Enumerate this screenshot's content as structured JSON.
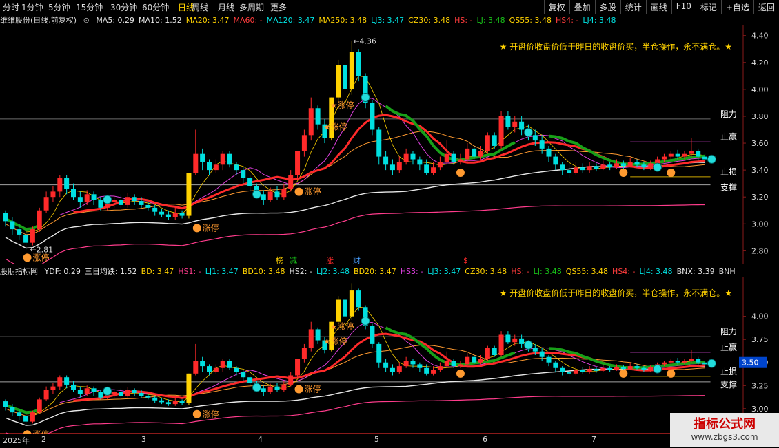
{
  "periods": [
    "分时",
    "1分钟",
    "5分钟",
    "15分钟",
    "30分钟",
    "60分钟",
    "日线",
    "周线",
    "月线",
    "多周期",
    "更多"
  ],
  "active_period": "日线",
  "right_tools": [
    "复权",
    "叠加",
    "多股",
    "统计",
    "画线",
    "F10",
    "标记",
    "+自选",
    "返回"
  ],
  "colors": {
    "up": "#ff2a2a",
    "down": "#00e0e0",
    "yellow": "#ffd200",
    "green": "#18a018",
    "white": "#e8e8e8",
    "pink": "#ff3c8c",
    "magenta": "#e040e0",
    "orange": "#ff9a30"
  },
  "main_panel": {
    "stock_title": "维维股份(日线,前复权)",
    "legend": [
      {
        "text": "MA5: 0.29",
        "color": "#e8e8e8"
      },
      {
        "text": "MA10: 1.52",
        "color": "#e8e8e8"
      },
      {
        "text": "MA20: 3.47",
        "color": "#ffd200"
      },
      {
        "text": "MA60: -",
        "color": "#ff3c3c"
      },
      {
        "text": "MA120: 3.47",
        "color": "#00e0e0"
      },
      {
        "text": "MA250: 3.48",
        "color": "#ffd200"
      },
      {
        "text": "LJ3: 3.47",
        "color": "#00e0e0"
      },
      {
        "text": "CZ30: 3.48",
        "color": "#ffd200"
      },
      {
        "text": "HS: -",
        "color": "#ff3c3c"
      },
      {
        "text": "LJ: 3.48",
        "color": "#18c018"
      },
      {
        "text": "QS55: 3.48",
        "color": "#ffd200"
      },
      {
        "text": "HS4: -",
        "color": "#ff3c3c"
      },
      {
        "text": "LJ4: 3.48",
        "color": "#00e0e0"
      }
    ],
    "note": "★ 开盘价收盘价低于昨日的收盘价买，半仓操作，永不满仓。★",
    "labels": {
      "resist": "阻力",
      "profit": "止赢",
      "stop": "止损",
      "support": "支撑",
      "limit_up": "涨停",
      "high": "4.36",
      "low": "2.81"
    },
    "axis_ticks": [
      "4.40",
      "4.20",
      "4.00",
      "3.80",
      "3.60",
      "3.40",
      "3.20",
      "3.00",
      "2.80"
    ],
    "markers": [
      "榜",
      "减",
      "涨",
      "财",
      "$"
    ]
  },
  "sub_panel": {
    "title": "股朋指标网",
    "legend": [
      {
        "text": "YDF: 0.29",
        "color": "#e8e8e8"
      },
      {
        "text": "三日均跌: 1.52",
        "color": "#e8e8e8"
      },
      {
        "text": "BD: 3.47",
        "color": "#ffd200"
      },
      {
        "text": "HS1: -",
        "color": "#ff3c8c"
      },
      {
        "text": "LJ1: 3.47",
        "color": "#00e0e0"
      },
      {
        "text": "BD10: 3.48",
        "color": "#ffd200"
      },
      {
        "text": "HS2: -",
        "color": "#e8e8e8"
      },
      {
        "text": "LJ2: 3.48",
        "color": "#00e0e0"
      },
      {
        "text": "BD20: 3.47",
        "color": "#ffd200"
      },
      {
        "text": "HS3: -",
        "color": "#e040e0"
      },
      {
        "text": "LJ3: 3.47",
        "color": "#00e0e0"
      },
      {
        "text": "CZ30: 3.48",
        "color": "#ffd200"
      },
      {
        "text": "HS: -",
        "color": "#ff3c3c"
      },
      {
        "text": "LJ: 3.48",
        "color": "#18c018"
      },
      {
        "text": "QS55: 3.48",
        "color": "#ffd200"
      },
      {
        "text": "HS4: -",
        "color": "#ff3c3c"
      },
      {
        "text": "LJ4: 3.48",
        "color": "#00e0e0"
      },
      {
        "text": "BNX: 3.39",
        "color": "#e8e8e8"
      },
      {
        "text": "BNH",
        "color": "#e8e8e8"
      }
    ],
    "note": "★ 开盘价收盘价低于昨日的收盘价买，半仓操作，永不满仓。★",
    "labels": {
      "resist": "阻力",
      "profit": "止赢",
      "stop": "止损",
      "support": "支撑",
      "limit_up": "涨停"
    },
    "axis_ticks": [
      "4.00",
      "3.75",
      "3.50",
      "3.25",
      "3.00"
    ],
    "current_price": "3.50"
  },
  "date_axis": [
    "2025年",
    "2",
    "3",
    "4",
    "5",
    "6",
    "7"
  ],
  "watermark": {
    "title": "指标公式网",
    "url": "www.zbgs3.com"
  },
  "chart_data": [
    {
      "type": "candlestick",
      "title": "维维股份(日线,前复权)",
      "ylim": [
        2.72,
        4.46
      ],
      "grid": false,
      "candles": [
        [
          3.08,
          3.02,
          3.1,
          2.98
        ],
        [
          3.02,
          2.96,
          3.05,
          2.92
        ],
        [
          2.96,
          2.92,
          3.0,
          2.88
        ],
        [
          2.92,
          2.86,
          2.95,
          2.81
        ],
        [
          2.86,
          2.96,
          2.98,
          2.84
        ],
        [
          2.96,
          3.1,
          3.12,
          2.94
        ],
        [
          3.1,
          3.2,
          3.24,
          3.08
        ],
        [
          3.2,
          3.24,
          3.28,
          3.16
        ],
        [
          3.24,
          3.34,
          3.36,
          3.2
        ],
        [
          3.34,
          3.26,
          3.36,
          3.22
        ],
        [
          3.26,
          3.2,
          3.3,
          3.18
        ],
        [
          3.2,
          3.16,
          3.24,
          3.12
        ],
        [
          3.16,
          3.22,
          3.25,
          3.14
        ],
        [
          3.22,
          3.18,
          3.24,
          3.14
        ],
        [
          3.18,
          3.12,
          3.2,
          3.1
        ],
        [
          3.12,
          3.16,
          3.19,
          3.1
        ],
        [
          3.16,
          3.18,
          3.21,
          3.12
        ],
        [
          3.18,
          3.14,
          3.22,
          3.12
        ],
        [
          3.14,
          3.2,
          3.23,
          3.12
        ],
        [
          3.2,
          3.17,
          3.22,
          3.14
        ],
        [
          3.17,
          3.14,
          3.2,
          3.12
        ],
        [
          3.14,
          3.12,
          3.16,
          3.1
        ],
        [
          3.12,
          3.09,
          3.14,
          3.06
        ],
        [
          3.09,
          3.07,
          3.11,
          3.05
        ],
        [
          3.07,
          3.05,
          3.1,
          3.03
        ],
        [
          3.05,
          3.08,
          3.12,
          3.03
        ],
        [
          3.08,
          3.06,
          3.1,
          3.04
        ],
        [
          3.06,
          3.38,
          3.38,
          3.04
        ],
        [
          3.38,
          3.52,
          3.7,
          3.36
        ],
        [
          3.52,
          3.46,
          3.56,
          3.4
        ],
        [
          3.46,
          3.4,
          3.48,
          3.36
        ],
        [
          3.4,
          3.44,
          3.48,
          3.38
        ],
        [
          3.44,
          3.52,
          3.54,
          3.4
        ],
        [
          3.52,
          3.44,
          3.54,
          3.42
        ],
        [
          3.44,
          3.4,
          3.46,
          3.36
        ],
        [
          3.4,
          3.34,
          3.42,
          3.3
        ],
        [
          3.34,
          3.28,
          3.36,
          3.24
        ],
        [
          3.28,
          3.22,
          3.3,
          3.2
        ],
        [
          3.22,
          3.18,
          3.25,
          3.14
        ],
        [
          3.18,
          3.24,
          3.27,
          3.16
        ],
        [
          3.24,
          3.2,
          3.28,
          3.18
        ],
        [
          3.2,
          3.26,
          3.3,
          3.18
        ],
        [
          3.26,
          3.36,
          3.4,
          3.24
        ],
        [
          3.36,
          3.54,
          3.54,
          3.34
        ],
        [
          3.54,
          3.66,
          3.7,
          3.5
        ],
        [
          3.66,
          3.86,
          3.94,
          3.62
        ],
        [
          3.86,
          3.74,
          3.88,
          3.7
        ],
        [
          3.74,
          3.64,
          3.78,
          3.6
        ],
        [
          3.64,
          3.94,
          3.94,
          3.62
        ],
        [
          3.94,
          4.18,
          4.22,
          3.9
        ],
        [
          4.18,
          4.0,
          4.34,
          3.96
        ],
        [
          4.0,
          4.28,
          4.36,
          3.96
        ],
        [
          4.28,
          4.1,
          4.3,
          4.06
        ],
        [
          4.1,
          3.9,
          4.12,
          3.86
        ],
        [
          3.9,
          3.7,
          3.92,
          3.66
        ],
        [
          3.7,
          3.5,
          3.72,
          3.44
        ],
        [
          3.5,
          3.44,
          3.54,
          3.4
        ],
        [
          3.44,
          3.4,
          3.48,
          3.36
        ],
        [
          3.4,
          3.46,
          3.5,
          3.38
        ],
        [
          3.46,
          3.52,
          3.56,
          3.44
        ],
        [
          3.52,
          3.48,
          3.54,
          3.44
        ],
        [
          3.48,
          3.44,
          3.5,
          3.4
        ],
        [
          3.44,
          3.38,
          3.48,
          3.36
        ],
        [
          3.38,
          3.42,
          3.46,
          3.36
        ],
        [
          3.42,
          3.46,
          3.5,
          3.4
        ],
        [
          3.46,
          3.52,
          3.62,
          3.44
        ],
        [
          3.52,
          3.46,
          3.54,
          3.44
        ],
        [
          3.46,
          3.48,
          3.52,
          3.44
        ],
        [
          3.48,
          3.56,
          3.6,
          3.46
        ],
        [
          3.56,
          3.5,
          3.58,
          3.48
        ],
        [
          3.5,
          3.54,
          3.58,
          3.48
        ],
        [
          3.54,
          3.66,
          3.68,
          3.52
        ],
        [
          3.66,
          3.58,
          3.68,
          3.56
        ],
        [
          3.58,
          3.8,
          3.84,
          3.56
        ],
        [
          3.8,
          3.72,
          3.84,
          3.7
        ],
        [
          3.72,
          3.76,
          3.8,
          3.68
        ],
        [
          3.76,
          3.7,
          3.8,
          3.66
        ],
        [
          3.7,
          3.66,
          3.74,
          3.62
        ],
        [
          3.66,
          3.62,
          3.7,
          3.58
        ],
        [
          3.62,
          3.56,
          3.66,
          3.52
        ],
        [
          3.56,
          3.5,
          3.58,
          3.46
        ],
        [
          3.5,
          3.44,
          3.52,
          3.4
        ],
        [
          3.44,
          3.4,
          3.46,
          3.36
        ],
        [
          3.4,
          3.38,
          3.44,
          3.34
        ],
        [
          3.38,
          3.42,
          3.46,
          3.36
        ],
        [
          3.42,
          3.4,
          3.45,
          3.38
        ],
        [
          3.4,
          3.43,
          3.46,
          3.38
        ],
        [
          3.43,
          3.41,
          3.45,
          3.39
        ],
        [
          3.41,
          3.44,
          3.47,
          3.4
        ],
        [
          3.44,
          3.42,
          3.46,
          3.4
        ],
        [
          3.42,
          3.45,
          3.48,
          3.41
        ],
        [
          3.45,
          3.43,
          3.47,
          3.41
        ],
        [
          3.43,
          3.46,
          3.49,
          3.42
        ],
        [
          3.46,
          3.44,
          3.48,
          3.42
        ],
        [
          3.44,
          3.42,
          3.46,
          3.4
        ],
        [
          3.42,
          3.45,
          3.47,
          3.4
        ],
        [
          3.45,
          3.48,
          3.5,
          3.43
        ],
        [
          3.48,
          3.5,
          3.52,
          3.46
        ],
        [
          3.5,
          3.52,
          3.54,
          3.48
        ],
        [
          3.52,
          3.5,
          3.55,
          3.48
        ],
        [
          3.5,
          3.52,
          3.54,
          3.48
        ],
        [
          3.52,
          3.54,
          3.64,
          3.5
        ],
        [
          3.54,
          3.5,
          3.56,
          3.47
        ],
        [
          3.5,
          3.48,
          3.52,
          3.45
        ]
      ],
      "levels": {
        "resist": 3.78,
        "profit": 3.61,
        "stop": 3.35,
        "support": 3.29
      }
    }
  ]
}
